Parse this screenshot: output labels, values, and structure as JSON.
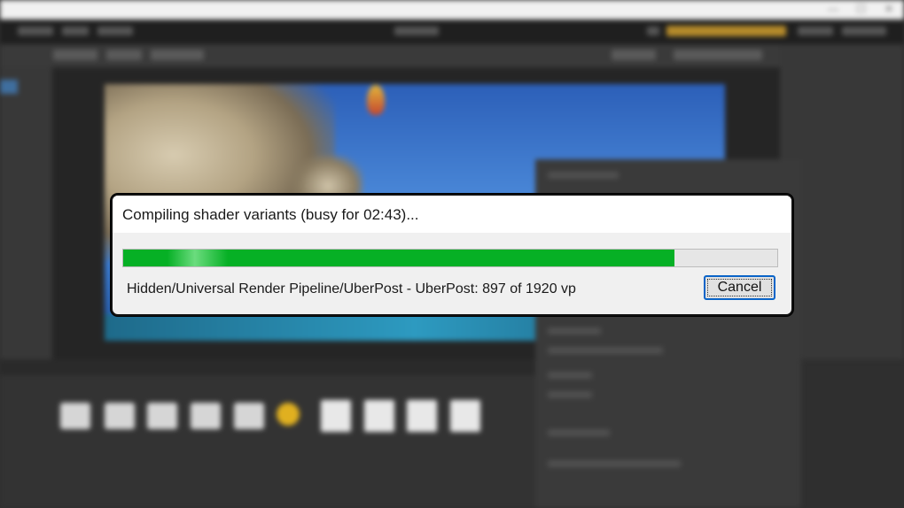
{
  "dialog": {
    "title": "Compiling shader variants (busy for 02:43)...",
    "progress_fraction": 0.843,
    "progress_color": "#06b025",
    "status": "Hidden/Universal Render Pipeline/UberPost - UberPost: 897 of 1920 vp",
    "cancel_label": "Cancel"
  },
  "background": {
    "note_colors": {
      "titlebar": "#f1f1f1",
      "editor": "#2f2f2f",
      "account_accent": "#b48a2a"
    },
    "window_controls": [
      "—",
      "☐",
      "✕"
    ]
  }
}
